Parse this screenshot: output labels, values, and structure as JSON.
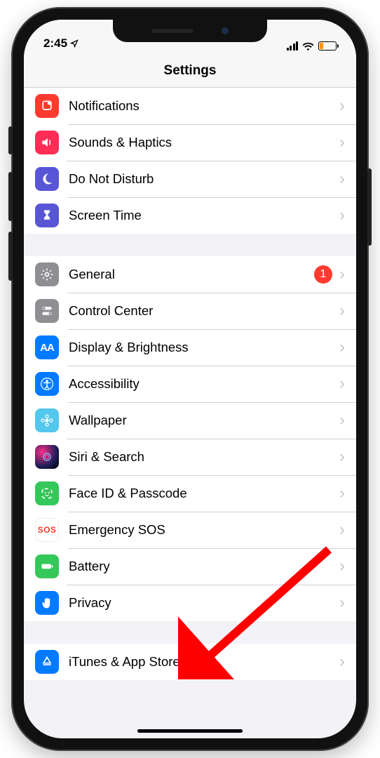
{
  "status": {
    "time": "2:45"
  },
  "header": {
    "title": "Settings"
  },
  "groups": [
    {
      "rows": [
        {
          "key": "notifications",
          "label": "Notifications",
          "iconClass": "ic-notif",
          "icon": "bell"
        },
        {
          "key": "sounds",
          "label": "Sounds & Haptics",
          "iconClass": "ic-sounds",
          "icon": "speaker"
        },
        {
          "key": "dnd",
          "label": "Do Not Disturb",
          "iconClass": "ic-dnd",
          "icon": "moon"
        },
        {
          "key": "screentime",
          "label": "Screen Time",
          "iconClass": "ic-screentime",
          "icon": "hourglass"
        }
      ]
    },
    {
      "rows": [
        {
          "key": "general",
          "label": "General",
          "iconClass": "ic-general",
          "icon": "gear",
          "badge": "1"
        },
        {
          "key": "controlcenter",
          "label": "Control Center",
          "iconClass": "ic-control",
          "icon": "toggles"
        },
        {
          "key": "display",
          "label": "Display & Brightness",
          "iconClass": "ic-display",
          "icon": "aa"
        },
        {
          "key": "accessibility",
          "label": "Accessibility",
          "iconClass": "ic-access",
          "icon": "access"
        },
        {
          "key": "wallpaper",
          "label": "Wallpaper",
          "iconClass": "ic-wallpaper",
          "icon": "flower"
        },
        {
          "key": "siri",
          "label": "Siri & Search",
          "iconClass": "ic-siri",
          "icon": "siri"
        },
        {
          "key": "faceid",
          "label": "Face ID & Passcode",
          "iconClass": "ic-faceid",
          "icon": "face"
        },
        {
          "key": "sos",
          "label": "Emergency SOS",
          "iconClass": "ic-sos",
          "icon": "sos"
        },
        {
          "key": "battery",
          "label": "Battery",
          "iconClass": "ic-battery",
          "icon": "battery"
        },
        {
          "key": "privacy",
          "label": "Privacy",
          "iconClass": "ic-privacy",
          "icon": "hand"
        }
      ]
    },
    {
      "rows": [
        {
          "key": "itunes",
          "label": "iTunes & App Store",
          "iconClass": "ic-itunes",
          "icon": "appstore"
        }
      ]
    }
  ],
  "annotation": {
    "arrow_target": "privacy",
    "arrow_color": "#ff0000"
  }
}
